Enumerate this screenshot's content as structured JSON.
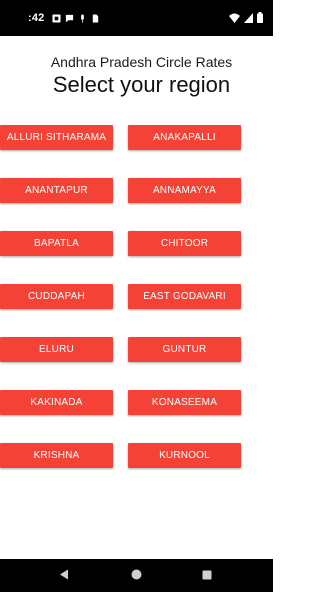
{
  "status_bar": {
    "time": ":42",
    "icons": [
      "notification-icon",
      "chat-icon",
      "mic-icon",
      "sim-icon",
      "wifi-icon",
      "signal-icon",
      "battery-icon"
    ]
  },
  "header": {
    "subtitle": "Andhra Pradesh Circle Rates",
    "title": "Select your region"
  },
  "regions": [
    "ALLURI SITHARAMA",
    "ANAKAPALLI",
    "ANANTAPUR",
    "ANNAMAYYA",
    "BAPATLA",
    "CHITOOR",
    "CUDDAPAH",
    "EAST GODAVARI",
    "ELURU",
    "GUNTUR",
    "KAKINADA",
    "KONASEEMA",
    "KRISHNA",
    "KURNOOL"
  ],
  "colors": {
    "button": "#f44336",
    "button_text": "#ffffff",
    "system_bars": "#000000"
  }
}
